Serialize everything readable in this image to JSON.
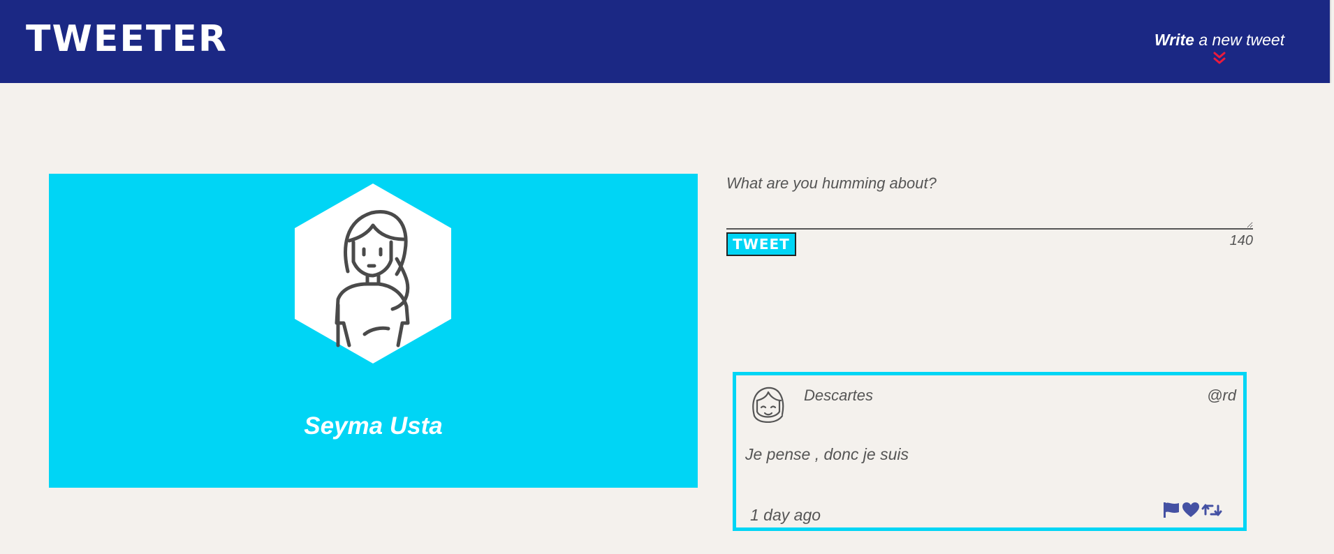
{
  "nav": {
    "logo": "TWEETER",
    "compose_strong": "Write",
    "compose_rest": " a new tweet",
    "accent_color": "#ec1a3c",
    "background": "#1b2884"
  },
  "profile": {
    "name": "Seyma Usta",
    "background": "#00d5f5"
  },
  "composer": {
    "placeholder": "What are you humming about?",
    "value": "",
    "button_label": "TWEET",
    "counter": "140"
  },
  "tweets": [
    {
      "author": "Descartes",
      "handle": "@rd",
      "text": "Je pense , donc je suis",
      "time": "1 day ago",
      "actions": [
        "flag-icon",
        "heart-icon",
        "retweet-icon"
      ]
    }
  ]
}
